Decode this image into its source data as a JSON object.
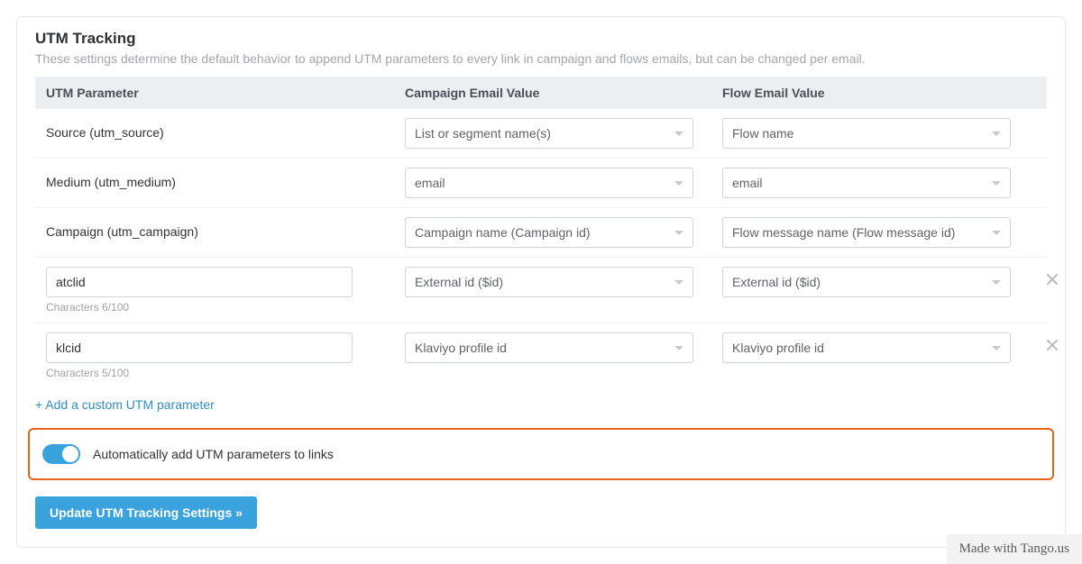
{
  "header": {
    "title": "UTM Tracking",
    "subtitle": "These settings determine the default behavior to append UTM parameters to every link in campaign and flows emails, but can be changed per email."
  },
  "columns": {
    "param": "UTM Parameter",
    "campaign": "Campaign Email Value",
    "flow": "Flow Email Value"
  },
  "rows": {
    "source": {
      "label": "Source (utm_source)",
      "campaign": "List or segment name(s)",
      "flow": "Flow name"
    },
    "medium": {
      "label": "Medium (utm_medium)",
      "campaign": "email",
      "flow": "email"
    },
    "campaignRow": {
      "label": "Campaign (utm_campaign)",
      "campaign": "Campaign name (Campaign id)",
      "flow": "Flow message name (Flow message id)"
    },
    "custom1": {
      "name": "atclid",
      "count": "Characters 6/100",
      "campaign": "External id ($id)",
      "flow": "External id ($id)"
    },
    "custom2": {
      "name": "klcid",
      "count": "Characters 5/100",
      "campaign": "Klaviyo profile id",
      "flow": "Klaviyo profile id"
    }
  },
  "addLink": "+ Add a custom UTM parameter",
  "toggleLabel": "Automatically add UTM parameters to links",
  "updateBtn": "Update UTM Tracking Settings »",
  "watermark": "Made with Tango.us"
}
